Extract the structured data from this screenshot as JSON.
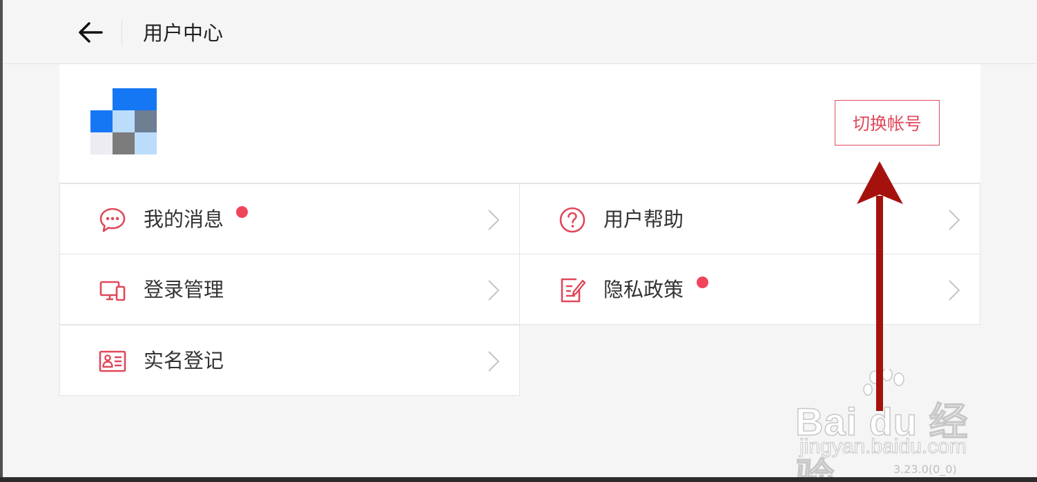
{
  "header": {
    "back_icon": "arrow-left-icon",
    "title": "用户中心"
  },
  "profile": {
    "avatar": "pixelated-avatar",
    "switch_account_label": "切换帐号",
    "accent_color": "#e0485a"
  },
  "menu": [
    {
      "label": "我的消息",
      "icon": "message-bubble-icon",
      "has_dot": true
    },
    {
      "label": "用户帮助",
      "icon": "question-circle-icon",
      "has_dot": false
    },
    {
      "label": "登录管理",
      "icon": "devices-icon",
      "has_dot": false
    },
    {
      "label": "隐私政策",
      "icon": "document-edit-icon",
      "has_dot": true
    },
    {
      "label": "实名登记",
      "icon": "id-card-icon",
      "has_dot": false
    }
  ],
  "annotation": {
    "arrow_color": "#a5120e",
    "watermark_brand": "Bai du 经验",
    "watermark_url": "jingyan.baidu.com"
  },
  "version": "3.23.0(0_0)"
}
